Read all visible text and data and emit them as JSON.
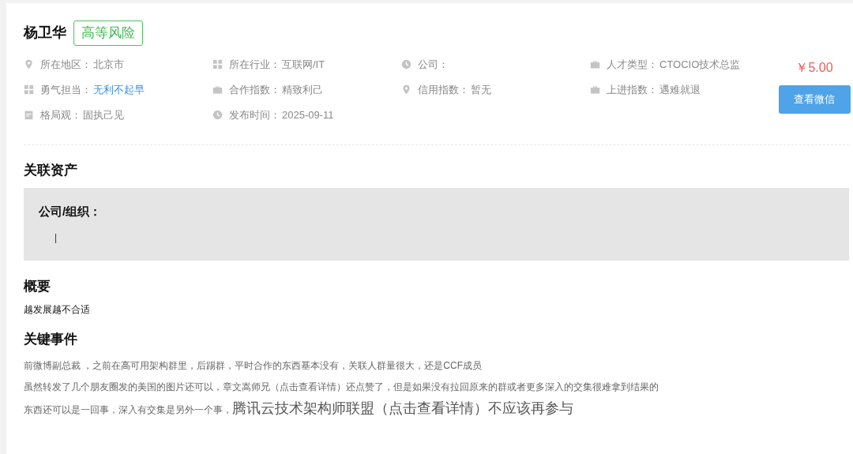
{
  "profile": {
    "name": "杨卫华",
    "risk_badge": "高等风险",
    "price": "￥5.00",
    "action_button": "查看微信"
  },
  "info_rows": [
    [
      {
        "kind": "pin",
        "label": "所在地区：",
        "value": "北京市",
        "link": false
      },
      {
        "kind": "grid",
        "label": "所在行业：",
        "value": "互联网/IT",
        "link": false
      },
      {
        "kind": "clock",
        "label": "公司："
      },
      {
        "kind": "briefcase",
        "label": "人才类型：",
        "value": "CTOCIO技术总监",
        "link": false
      }
    ],
    [
      {
        "kind": "grid",
        "label": "勇气担当：",
        "value": "无利不起早",
        "link": true
      },
      {
        "kind": "briefcase",
        "label": "合作指数：",
        "value": "精致利己",
        "link": false
      },
      {
        "kind": "pin",
        "label": "信用指数：",
        "value": "暂无",
        "link": false
      },
      {
        "kind": "briefcase",
        "label": "上进指数：",
        "value": "遇难就退",
        "link": false
      }
    ],
    [
      {
        "kind": "calendar",
        "label": "格局观：",
        "value": "固执己见",
        "link": false
      },
      {
        "kind": "clock",
        "label": "发布时间：",
        "value": "2025-09-11",
        "link": false
      }
    ]
  ],
  "assets": {
    "title": "关联资产",
    "box_label": "公司/组织：",
    "box_value": "|"
  },
  "summary": {
    "title": "概要",
    "text": "越发展越不合适"
  },
  "events": {
    "title": "关键事件",
    "lines": [
      [
        {
          "kind": "normal",
          "text": "前微博副总裁 ，之前在高可用架构群里，后踢群，平时合作的东西基本没有，关联人群量很大，还是CCF成员"
        }
      ],
      [
        {
          "kind": "normal",
          "text": "虽然转发了几个朋友圈发的美国的图片还可以，章文嵩师兄（点击查看详情）还点赞了，但是如果没有拉回原来的群或者更多深入的交集很难拿到结果的"
        }
      ],
      [
        {
          "kind": "normal",
          "text": "东西还可以是一回事，深入有交集是另外一个事，"
        },
        {
          "kind": "large",
          "text": "腾讯云技术架构师联盟（点击查看详情）不应该再参与"
        }
      ]
    ]
  }
}
